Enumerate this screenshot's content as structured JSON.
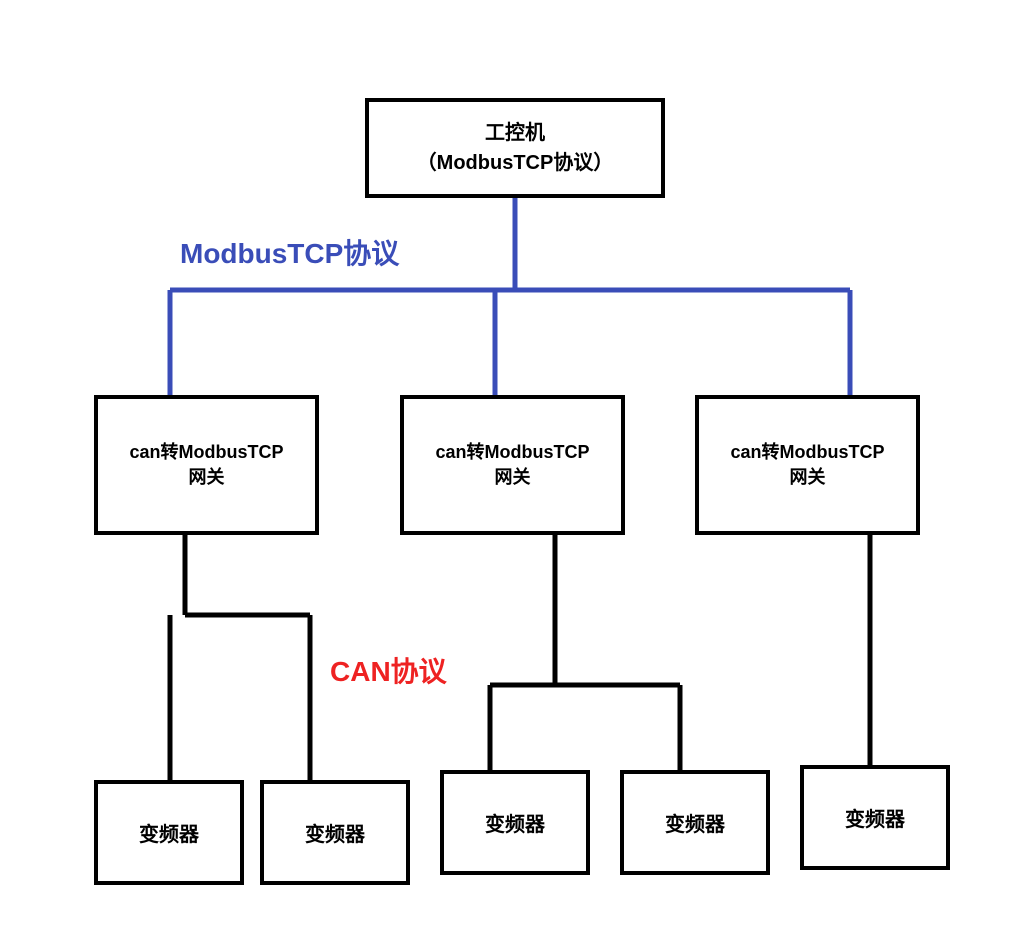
{
  "top": {
    "line1": "工控机",
    "line2": "（ModbusTCP协议）"
  },
  "protocol_label_top": "ModbusTCP协议",
  "gateways": {
    "g1": {
      "line1": "can转ModbusTCP",
      "line2": "网关"
    },
    "g2": {
      "line1": "can转ModbusTCP",
      "line2": "网关"
    },
    "g3": {
      "line1": "can转ModbusTCP",
      "line2": "网关"
    }
  },
  "protocol_label_bottom": "CAN协议",
  "vfd": {
    "v1": "变频器",
    "v2": "变频器",
    "v3": "变频器",
    "v4": "变频器",
    "v5": "变频器"
  }
}
